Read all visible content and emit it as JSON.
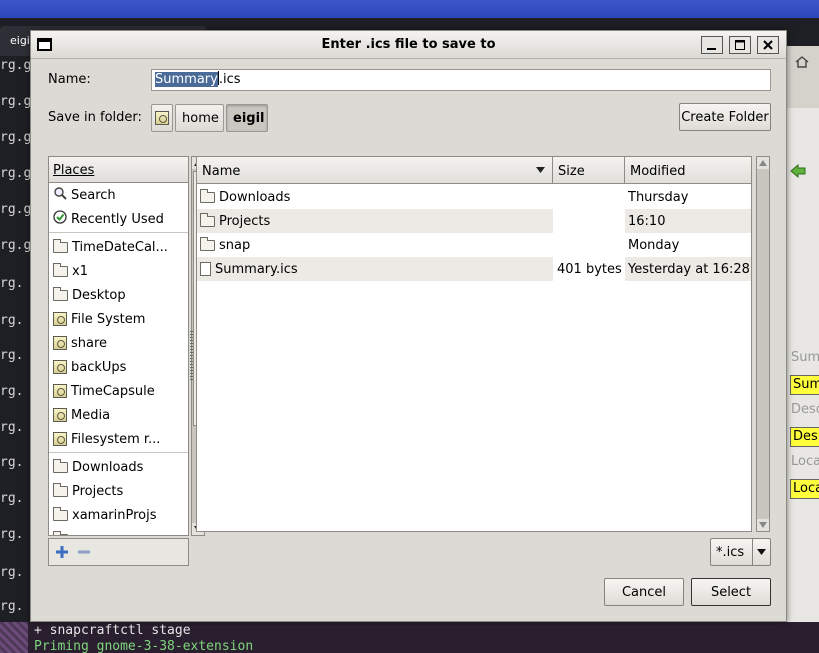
{
  "background": {
    "terminal_tab": "eigi",
    "term_lines": [
      "rg.g",
      "rg.g",
      "rg.g",
      "rg.g",
      "rg.g",
      "rg.g",
      "rg.",
      "rg.",
      "rg.",
      "rg.",
      "rg.",
      "rg.",
      "rg.",
      "rg.",
      "rg.",
      "rg."
    ],
    "bottom_lines": [
      "+ snapcraftctl stage",
      "Priming gnome-3-38-extension"
    ],
    "right_labels": [
      "Sum",
      "Desc",
      "Loca"
    ],
    "right_fields": [
      "Sum",
      "Des",
      "Loca"
    ],
    "colors": {
      "field_yellow": "#ffff3c",
      "prompt_green": "#7ed67e"
    }
  },
  "dialog": {
    "title": "Enter .ics file to save to",
    "name_label": "Name:",
    "name_value_selected": "Summary",
    "name_value_rest": ".ics",
    "save_in_label": "Save in folder:",
    "path": [
      "home",
      "eigil"
    ],
    "create_folder": "Create Folder",
    "places_header": "Places",
    "places": [
      {
        "icon": "search-icon",
        "label": "Search"
      },
      {
        "icon": "recent-icon",
        "label": "Recently Used"
      },
      {
        "icon": "folder-icon",
        "label": "TimeDateCal..."
      },
      {
        "icon": "folder-icon",
        "label": "x1"
      },
      {
        "icon": "folder-icon",
        "label": "Desktop"
      },
      {
        "icon": "drive-icon",
        "label": "File System"
      },
      {
        "icon": "drive-icon",
        "label": "share"
      },
      {
        "icon": "drive-icon",
        "label": "backUps"
      },
      {
        "icon": "drive-icon",
        "label": "TimeCapsule"
      },
      {
        "icon": "drive-icon",
        "label": "Media"
      },
      {
        "icon": "drive-icon",
        "label": "Filesystem r..."
      },
      {
        "icon": "folder-icon",
        "label": "Downloads"
      },
      {
        "icon": "folder-icon",
        "label": "Projects"
      },
      {
        "icon": "folder-icon",
        "label": "xamarinProjs"
      }
    ],
    "columns": {
      "name": "Name",
      "size": "Size",
      "modified": "Modified"
    },
    "files": [
      {
        "icon": "folder-icon",
        "name": "Downloads",
        "size": "",
        "modified": "Thursday"
      },
      {
        "icon": "folder-icon",
        "name": "Projects",
        "size": "",
        "modified": "16:10"
      },
      {
        "icon": "folder-icon",
        "name": "snap",
        "size": "",
        "modified": "Monday"
      },
      {
        "icon": "file-icon",
        "name": "Summary.ics",
        "size": "401 bytes",
        "modified": "Yesterday at 16:28"
      }
    ],
    "filter": "*.ics",
    "cancel": "Cancel",
    "select": "Select"
  }
}
